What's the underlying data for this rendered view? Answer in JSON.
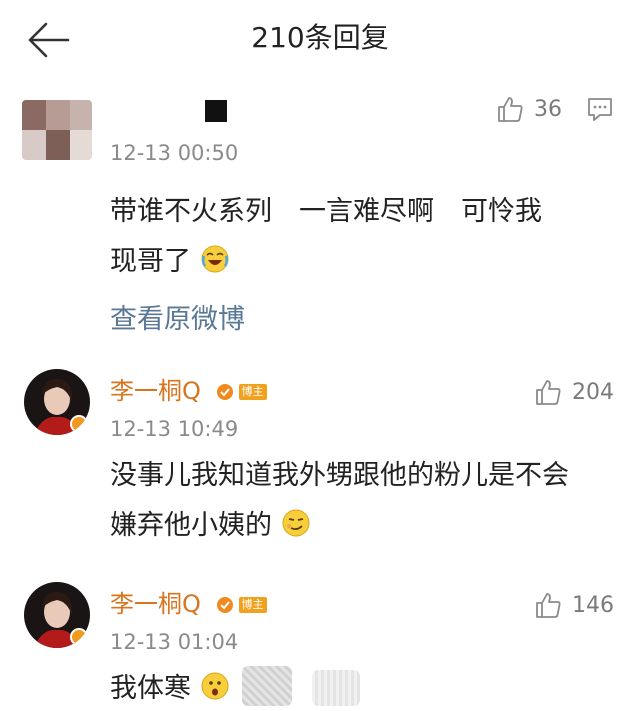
{
  "header": {
    "title": "210条回复"
  },
  "comments": [
    {
      "name": "",
      "time": "12-13 00:50",
      "text_line1": "带谁不火系列　一言难尽啊　可怜我",
      "text_line2": "现哥了",
      "link": "查看原微博",
      "likes": "36"
    },
    {
      "name": "李一桐Q",
      "badge": "博主",
      "time": "12-13 10:49",
      "text_line1": "没事儿我知道我外甥跟他的粉儿是不会",
      "text_line2": "嫌弃他小姨的",
      "likes": "204"
    },
    {
      "name": "李一桐Q",
      "badge": "博主",
      "time": "12-13 01:04",
      "text_line1": "我体寒",
      "likes": "146"
    }
  ],
  "colors": {
    "username": "#d9741f",
    "link": "#5a7896",
    "meta": "#8a8a8a"
  }
}
